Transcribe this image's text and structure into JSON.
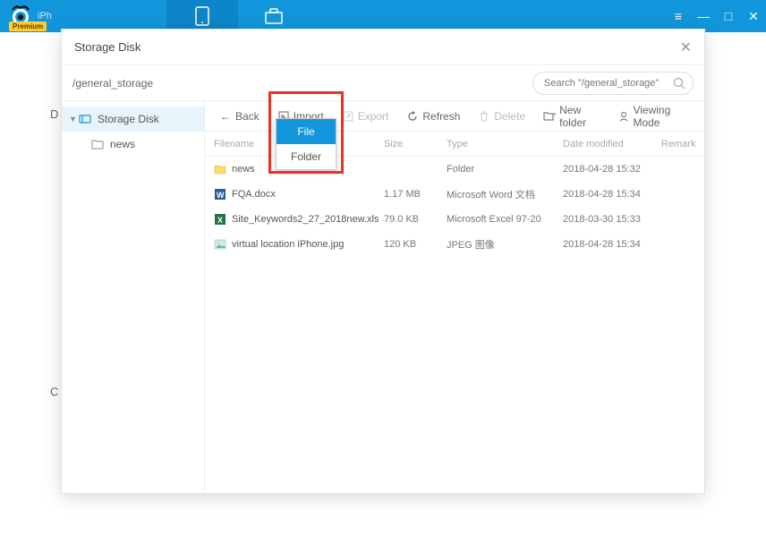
{
  "titlebar": {
    "logo_text": "iPh",
    "premium": "Premium"
  },
  "modal": {
    "title": "Storage Disk",
    "path": "/general_storage",
    "search_placeholder": "Search \"/general_storage\""
  },
  "sidebar": {
    "root": "Storage Disk",
    "child": "news"
  },
  "toolbar": {
    "back": "Back",
    "import": "Import",
    "export": "Export",
    "refresh": "Refresh",
    "delete": "Delete",
    "newfolder": "New folder",
    "viewmode": "Viewing Mode"
  },
  "columns": {
    "filename": "Filename",
    "size": "Size",
    "type": "Type",
    "date": "Date modified",
    "remark": "Remark"
  },
  "files": [
    {
      "name": "news",
      "size": "",
      "type": "Folder",
      "date": "2018-04-28 15:32",
      "icon": "folder"
    },
    {
      "name": "FQA.docx",
      "size": "1.17 MB",
      "type": "Microsoft Word 文档",
      "date": "2018-04-28 15:34",
      "icon": "word"
    },
    {
      "name": "Site_Keywords2_27_2018new.xls",
      "size": "79.0 KB",
      "type": "Microsoft Excel 97-20",
      "date": "2018-03-30 15:33",
      "icon": "excel"
    },
    {
      "name": "virtual location iPhone.jpg",
      "size": "120 KB",
      "type": "JPEG 图像",
      "date": "2018-04-28 15:34",
      "icon": "image"
    }
  ],
  "dropdown": {
    "file": "File",
    "folder": "Folder"
  },
  "bg": {
    "d": "D",
    "c": "C"
  }
}
